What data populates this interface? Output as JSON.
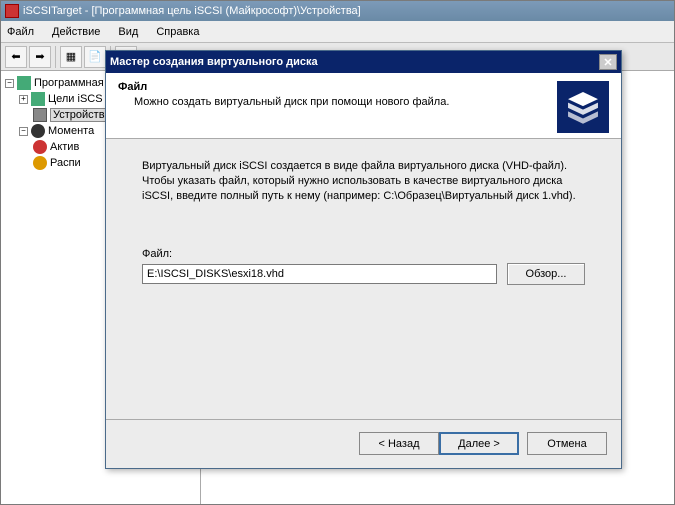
{
  "window": {
    "title": "iSCSITarget - [Программная цель iSCSI (Майкрософт)\\Устройства]"
  },
  "menu": {
    "file": "Файл",
    "action": "Действие",
    "view": "Вид",
    "help": "Справка"
  },
  "tree": {
    "root": "Программная",
    "targets": "Цели iSCS",
    "devices": "Устройств",
    "snapshots": "Момента",
    "active": "Актив",
    "schedule": "Распи"
  },
  "wizard": {
    "title": "Мастер создания виртуального диска",
    "header_title": "Файл",
    "header_sub": "Можно создать виртуальный диск при помощи нового файла.",
    "body_text": "Виртуальный диск iSCSI создается в виде файла виртуального диска (VHD-файл). Чтобы указать файл, который нужно использовать в качестве виртуального диска iSCSI, введите полный путь к нему (например: C:\\Образец\\Виртуальный диск 1.vhd).",
    "file_label": "Файл:",
    "file_value": "E:\\ISCSI_DISKS\\esxi18.vhd",
    "browse": "Обзор...",
    "back": "< Назад",
    "next": "Далее >",
    "cancel": "Отмена"
  }
}
